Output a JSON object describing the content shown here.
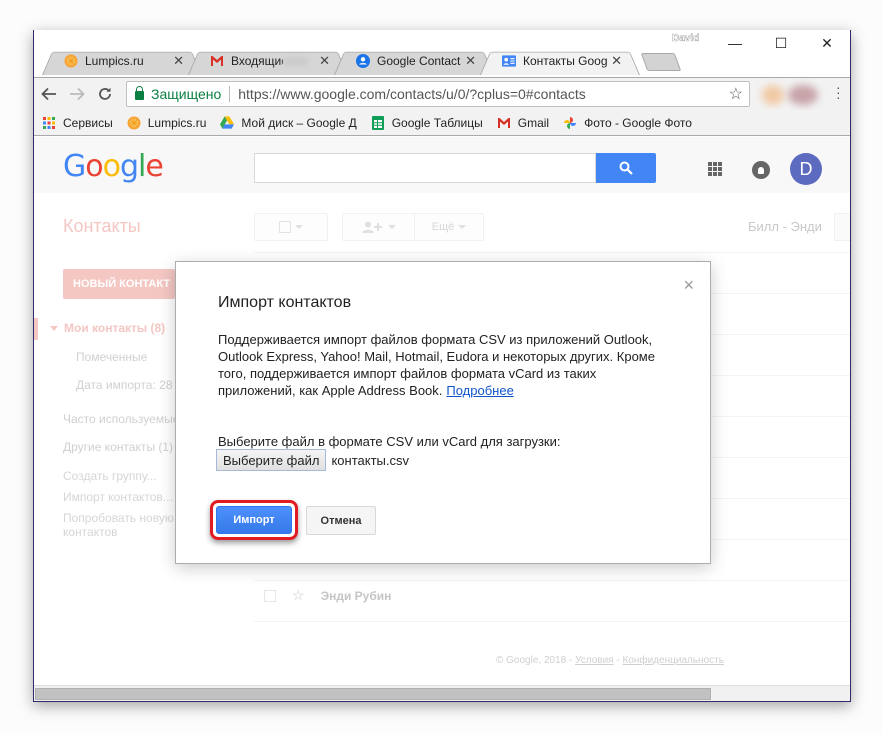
{
  "browser": {
    "profile_name": "David",
    "tabs": [
      {
        "label": "Lumpics.ru",
        "icon": "orange-icon",
        "active": false
      },
      {
        "label": "Входящие - ",
        "icon": "gmail-icon",
        "active": false
      },
      {
        "label": "Google Contacts",
        "icon": "google-contacts-icon",
        "active": false
      },
      {
        "label": "Контакты Google",
        "icon": "contacts-card-icon",
        "active": true
      }
    ],
    "window_controls": {
      "minimize": "—",
      "maximize": "☐",
      "close": "✕"
    },
    "security_label": "Защищено",
    "url": "https://www.google.com/contacts/u/0/?cplus=0#contacts",
    "bookmarks": [
      {
        "label": "Сервисы",
        "icon": "apps-grid-icon"
      },
      {
        "label": "Lumpics.ru",
        "icon": "orange-icon"
      },
      {
        "label": "Мой диск – Google Д",
        "icon": "google-drive-icon"
      },
      {
        "label": "Google Таблицы",
        "icon": "google-sheets-icon"
      },
      {
        "label": "Gmail",
        "icon": "gmail-icon"
      },
      {
        "label": "Фото - Google Фото",
        "icon": "google-photos-icon"
      }
    ]
  },
  "page": {
    "logo": "Google",
    "avatar_letter": "D",
    "title": "Контакты",
    "more_label": "Ещё",
    "range_label": "Билл - Энди",
    "new_contact_label": "НОВЫЙ КОНТАКТ",
    "sidebar": {
      "my_contacts": "Мои контакты (8)",
      "starred": "Помеченные",
      "import_date": "Дата импорта: 28",
      "frequent": "Часто используемые",
      "other": "Другие контакты (1)",
      "create_group": "Создать группу...",
      "import_contacts": "Импорт контактов...",
      "try_new_1": "Попробовать новую версию",
      "try_new_2": "контактов"
    },
    "bg_contact_name": "Энди Рубин",
    "footer": {
      "copyright": "© Google, 2018 - ",
      "terms": "Условия",
      "dash": " - ",
      "privacy": "Конфиденциальность"
    }
  },
  "dialog": {
    "title": "Импорт контактов",
    "body": "Поддерживается импорт файлов формата CSV из приложений Outlook, Outlook Express, Yahoo! Mail, Hotmail, Eudora и некоторых других. Кроме того, поддерживается импорт файлов формата vCard из таких приложений, как Apple Address Book.",
    "learn_more": "Подробнее",
    "choose_label": "Выберите файл в формате CSV или vCard для загрузки:",
    "choose_button": "Выберите файл",
    "file_name": "контакты.csv",
    "import_button": "Импорт",
    "cancel_button": "Отмена",
    "close_glyph": "×"
  },
  "colors": {
    "accent_blue": "#4285f4",
    "import_blue": "#4d90fe",
    "highlight_red": "#e01b22",
    "secure_green": "#0b8043",
    "avatar": "#5c6bc0",
    "faded_red": "#f4c7c3"
  }
}
